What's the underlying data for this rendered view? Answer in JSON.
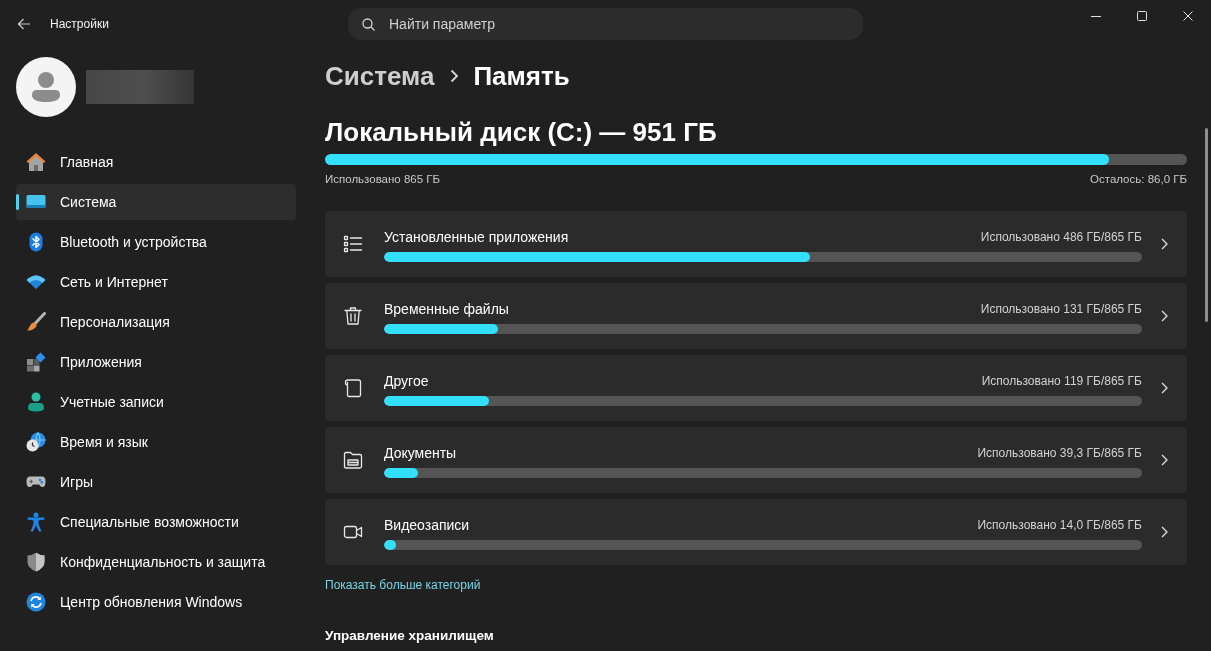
{
  "window": {
    "title": "Настройки"
  },
  "search": {
    "placeholder": "Найти параметр"
  },
  "sidebar": {
    "items": [
      {
        "label": "Главная",
        "selected": false
      },
      {
        "label": "Система",
        "selected": true
      },
      {
        "label": "Bluetooth и устройства",
        "selected": false
      },
      {
        "label": "Сеть и Интернет",
        "selected": false
      },
      {
        "label": "Персонализация",
        "selected": false
      },
      {
        "label": "Приложения",
        "selected": false
      },
      {
        "label": "Учетные записи",
        "selected": false
      },
      {
        "label": "Время и язык",
        "selected": false
      },
      {
        "label": "Игры",
        "selected": false
      },
      {
        "label": "Специальные возможности",
        "selected": false
      },
      {
        "label": "Конфиденциальность и защита",
        "selected": false
      },
      {
        "label": "Центр обновления Windows",
        "selected": false
      }
    ]
  },
  "breadcrumb": {
    "parent": "Система",
    "current": "Память"
  },
  "drive": {
    "title": "Локальный диск (C:) — 951 ГБ",
    "level": 0.91,
    "used": "Использовано 865 ГБ",
    "free": "Осталось: 86,0 ГБ"
  },
  "categories": [
    {
      "name": "Установленные приложения",
      "usage": "Использовано 486 ГБ/865 ГБ",
      "level": 0.562
    },
    {
      "name": "Временные файлы",
      "usage": "Использовано 131 ГБ/865 ГБ",
      "level": 0.151
    },
    {
      "name": "Другое",
      "usage": "Использовано 119 ГБ/865 ГБ",
      "level": 0.138
    },
    {
      "name": "Документы",
      "usage": "Использовано 39,3 ГБ/865 ГБ",
      "level": 0.045
    },
    {
      "name": "Видеозаписи",
      "usage": "Использовано 14,0 ГБ/865 ГБ",
      "level": 0.016
    }
  ],
  "more_link": "Показать больше категорий",
  "section_heading": "Управление хранилищем"
}
